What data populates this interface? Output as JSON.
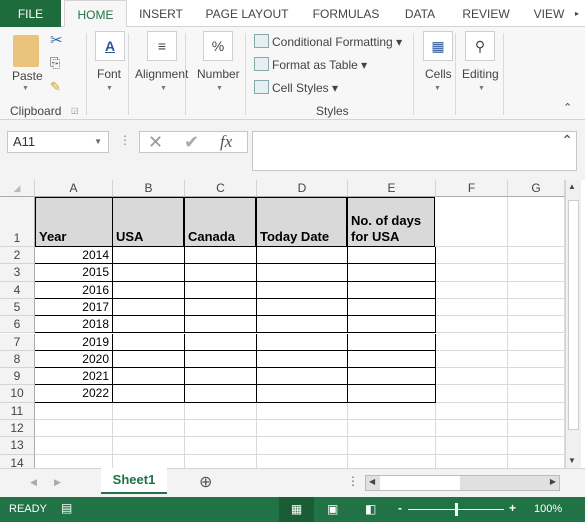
{
  "tabs": [
    "FILE",
    "HOME",
    "INSERT",
    "PAGE LAYOUT",
    "FORMULAS",
    "DATA",
    "REVIEW",
    "VIEW"
  ],
  "ribbon": {
    "paste": "Paste",
    "clipboard": "Clipboard",
    "font": "Font",
    "alignment": "Alignment",
    "number": "Number",
    "number_icon": "%",
    "conditional": "Conditional Formatting",
    "format_table": "Format as Table",
    "cell_styles": "Cell Styles",
    "styles": "Styles",
    "cells": "Cells",
    "editing": "Editing"
  },
  "formula_bar": {
    "name_box": "A11",
    "fx": "fx",
    "value": ""
  },
  "columns": [
    "A",
    "B",
    "C",
    "D",
    "E",
    "F",
    "G"
  ],
  "rows": [
    "1",
    "2",
    "3",
    "4",
    "5",
    "6",
    "7",
    "8",
    "9",
    "10",
    "11",
    "12",
    "13",
    "14"
  ],
  "headers": [
    "Year",
    "USA",
    "Canada",
    "Today Date",
    "No. of days for USA"
  ],
  "years": [
    "2014",
    "2015",
    "2016",
    "2017",
    "2018",
    "2019",
    "2020",
    "2021",
    "2022"
  ],
  "sheet_tab": "Sheet1",
  "status": {
    "ready": "READY",
    "zoom": "100%"
  },
  "colors": {
    "accent": "#217346",
    "header_fill": "#d9d9d9"
  }
}
